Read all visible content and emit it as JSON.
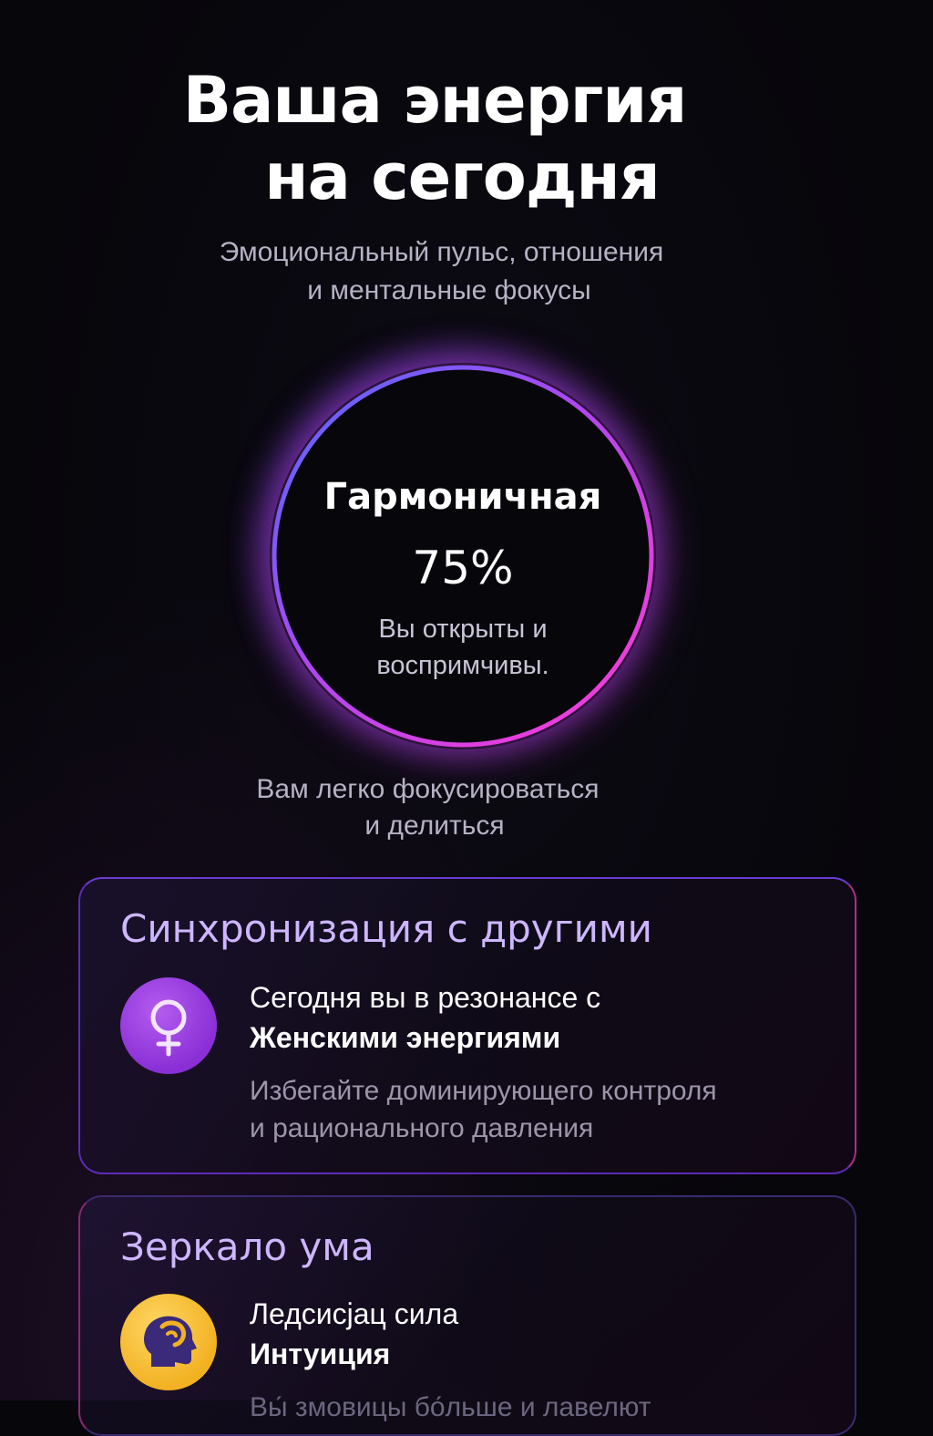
{
  "header": {
    "title_line1": "Ваша энергия",
    "title_line2": "на сегодня",
    "subtitle_line1": "Эмоциональный пульс, отношения",
    "subtitle_line2": "и ментальные фокусы"
  },
  "energy": {
    "state": "Гармоничная",
    "percent": "75%",
    "desc_line1": "Вы открыты и",
    "desc_line2": "воспримчивы."
  },
  "focus": {
    "line1": "Вам легко фокусироваться",
    "line2": "и делиться"
  },
  "cards": [
    {
      "title": "Синхронизация с другими",
      "icon": "female-symbol-icon",
      "line1": "Сегодня вы в резонансе с",
      "line2": "Женскими энергиями",
      "note_line1": "Избегайте доминирующего контроля",
      "note_line2": "и рационального давления",
      "accent": "#8a2fd6"
    },
    {
      "title": "Зеркало ума",
      "icon": "head-profile-icon",
      "line1": "Ледсисјац сила",
      "line2": "Интуиция",
      "note_line1": "Вы́ змовицы бо́льше и лавелют",
      "accent": "#f2b122"
    }
  ],
  "colors": {
    "ring_start": "#4f6bff",
    "ring_end": "#ff3ad6",
    "card_title": "#cdb6ff"
  }
}
